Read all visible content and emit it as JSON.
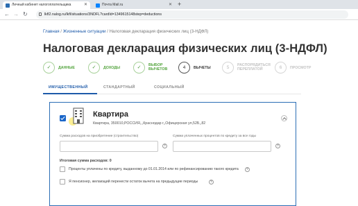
{
  "browser": {
    "tabs": [
      {
        "label": "Личный кабинет налогоплательщика",
        "active": true
      },
      {
        "label": "Почта Mail.ru",
        "active": false
      }
    ],
    "new_tab": "+",
    "url": "lkfl2.nalog.ru/lkfl/situations/3NDFL?cardId=1349615148step=deductions"
  },
  "breadcrumb": {
    "home": "Главная",
    "sep1": " / ",
    "section": "Жизненные ситуации",
    "sep2": " / ",
    "current": "Налоговая декларация физических лиц (3-НДФЛ)"
  },
  "page_title": "Налоговая декларация физических лиц (3-НДФЛ)",
  "steps": [
    {
      "mark": "✓",
      "label": "Данные",
      "state": "done"
    },
    {
      "mark": "✓",
      "label": "Доходы",
      "state": "done"
    },
    {
      "mark": "✓",
      "label": "Выбор вычетов",
      "state": "done"
    },
    {
      "mark": "4",
      "label": "Вычеты",
      "state": "current"
    },
    {
      "mark": "5",
      "label": "Распорядиться переплатой",
      "state": "todo"
    },
    {
      "mark": "6",
      "label": "Просмотр",
      "state": "todo"
    }
  ],
  "deduction_tabs": [
    {
      "label": "ИМУЩЕСТВЕННЫЙ",
      "active": true
    },
    {
      "label": "СТАНДАРТНЫЙ",
      "active": false
    },
    {
      "label": "СОЦИАЛЬНЫЙ",
      "active": false
    }
  ],
  "property": {
    "checked": true,
    "icon": "building-icon",
    "title": "Квартира",
    "address": "Квартира, 350010,РОССИЯ,,,Краснодар г,,Офицерская ул,52Б,,82"
  },
  "fields": {
    "purchase_label": "Сумма расходов на приобретение (строительство)",
    "purchase_value": "",
    "interest_label": "Сумма уплаченных процентов по кредиту за все годы",
    "interest_value": ""
  },
  "total_label": "Итоговая сумма расходов: 0",
  "checkboxes": [
    {
      "label": "Проценты уплачены по кредиту, выданному до 01.01.2014 или по рефинансированию такого кредита",
      "checked": false
    },
    {
      "label": "Я пенсионер, желающий перенести остаток вычета на предыдущие периоды",
      "checked": false
    }
  ],
  "help_glyph": "?",
  "colors": {
    "accent": "#1d5aa9",
    "done": "#52a33c",
    "checkbox": "#1a66c9",
    "card_border": "#2a6db5"
  }
}
